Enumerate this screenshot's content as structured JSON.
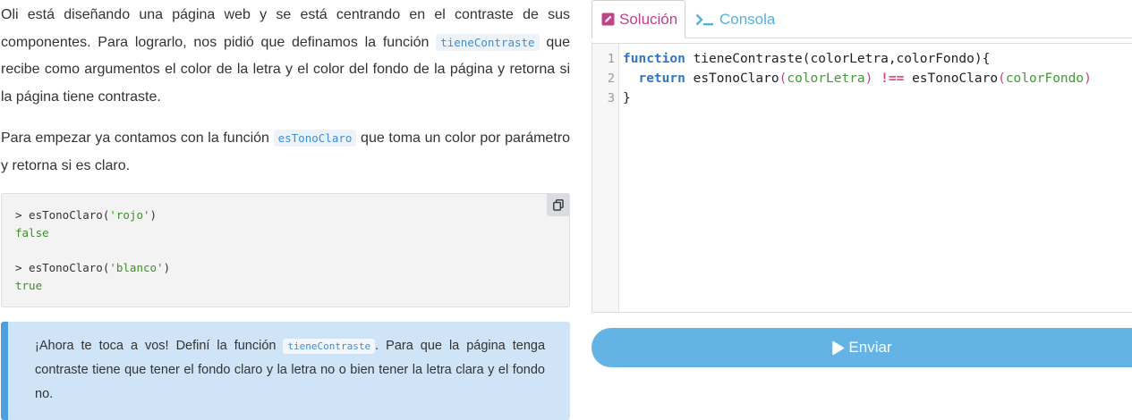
{
  "intro": {
    "p1_a": "Oli está diseñando una página web y se está centrando en el contraste de sus componentes. Para lograrlo, nos pidió que definamos la función ",
    "p1_code": "tieneContraste",
    "p1_b": " que recibe como argumentos el color de la letra y el color del fondo de la página y retorna si la página tiene contraste.",
    "p2_a": "Para empezar ya contamos con la función ",
    "p2_code": "esTonoClaro",
    "p2_b": " que toma un color por parámetro y retorna si es claro."
  },
  "example": {
    "call1_prefix": "> esTonoClaro(",
    "call1_arg": "'rojo'",
    "call1_suffix": ")",
    "result1": "false",
    "call2_prefix": "> esTonoClaro(",
    "call2_arg": "'blanco'",
    "call2_suffix": ")",
    "result2": "true",
    "copy_icon": "copy-icon"
  },
  "callout": {
    "a": "¡Ahora te toca a vos! Definí la función ",
    "code": "tieneContraste",
    "b": ". Para que la página tenga contraste tiene que tener el fondo claro y la letra no o bien tener la letra clara y el fondo no."
  },
  "tabs": {
    "solution": "Solución",
    "console": "Consola"
  },
  "editor": {
    "line_numbers": [
      "1",
      "2",
      "3"
    ],
    "l1_kw": "function",
    "l1_rest": " tieneContraste(colorLetra,colorFondo){",
    "l2_indent": "  ",
    "l2_kw": "return",
    "l2_fn1": " esTonoClaro",
    "l2_p1": "(",
    "l2_arg1": "colorLetra",
    "l2_p2": ")",
    "l2_op": " !== ",
    "l2_fn2": "esTonoClaro",
    "l2_p3": "(",
    "l2_arg2": "colorFondo",
    "l2_p4": ")",
    "l3": "}"
  },
  "submit": {
    "label": "Enviar",
    "icon": "play-icon"
  },
  "colors": {
    "accent_blue": "#63b4e4",
    "solution_tab": "#c2428a",
    "console_tab": "#55b0dc",
    "callout_bg": "#cfe4f6"
  }
}
